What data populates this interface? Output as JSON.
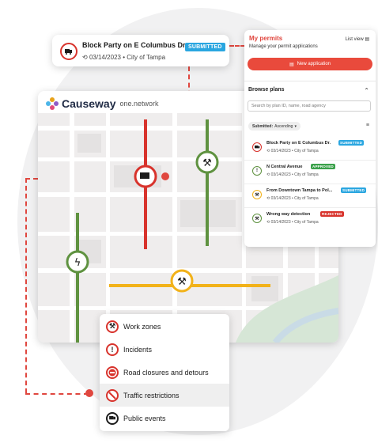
{
  "colors": {
    "accent": "#e0473f",
    "red": "#d8332c",
    "green": "#5f9240",
    "yellow": "#f2b21a",
    "blue": "#2aa6e0"
  },
  "header_card": {
    "title": "Block Party on E Columbus Dr.",
    "badge": "SUBMITTED",
    "date": "03/14/2023",
    "agency": "City of Tampa",
    "icon": "truck-icon"
  },
  "map": {
    "brand": "Causeway",
    "brand_suffix": "one.network"
  },
  "permits": {
    "title": "My permits",
    "subtitle": "Manage your permit applications",
    "list_view": "List view",
    "new_application": "New application",
    "browse_plans": "Browse plans",
    "search_placeholder": "Search by plan ID, name, road agency",
    "sort_label": "Submitted:",
    "sort_value": "Ascending",
    "plans": [
      {
        "title": "Block Party on E Columbus Dr.",
        "badge": "SUBMITTED",
        "date": "03/14/2023",
        "agency": "City of Tampa",
        "icon": "truck-icon"
      },
      {
        "title": "N Central Avenue",
        "badge": "APPROVED",
        "date": "03/14/2023",
        "agency": "City of Tampa",
        "icon": "exclamation-icon"
      },
      {
        "title": "From Downtown Tampa to Pol...",
        "badge": "SUBMITTED",
        "date": "03/14/2023",
        "agency": "City of Tampa",
        "icon": "worker-icon"
      },
      {
        "title": "Wrong way detection",
        "badge": "REJECTED",
        "date": "03/14/2023",
        "agency": "City of Tampa",
        "icon": "worker-icon"
      }
    ]
  },
  "legend": {
    "items": [
      {
        "label": "Work zones",
        "icon": "worker-icon"
      },
      {
        "label": "Incidents",
        "icon": "exclamation-icon"
      },
      {
        "label": "Road closures and detours",
        "icon": "no-entry-icon"
      },
      {
        "label": "Traffic restrictions",
        "icon": "restriction-icon"
      },
      {
        "label": "Public events",
        "icon": "truck-icon"
      }
    ]
  }
}
